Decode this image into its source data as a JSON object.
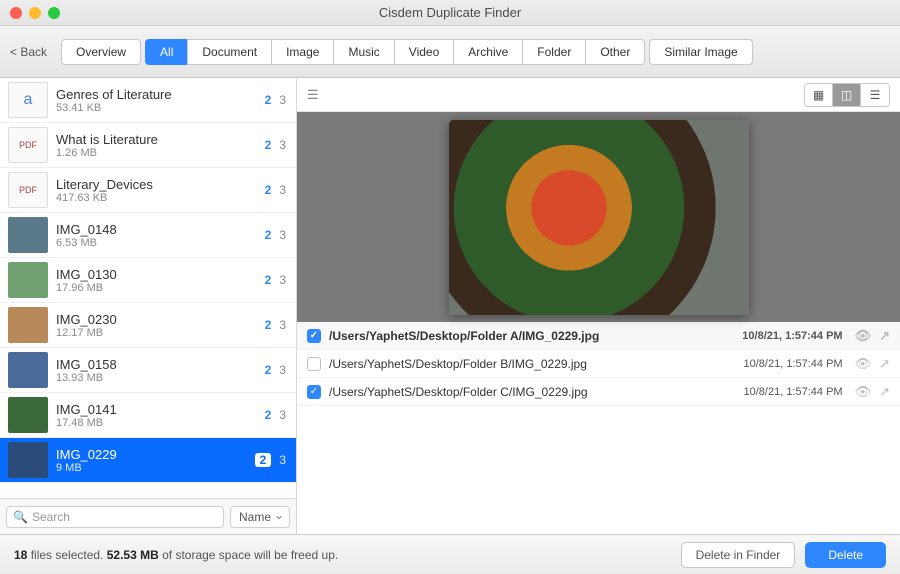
{
  "window": {
    "title": "Cisdem Duplicate Finder",
    "back": "< Back"
  },
  "tabs": {
    "overview": "Overview",
    "categories": [
      "All",
      "Document",
      "Image",
      "Music",
      "Video",
      "Archive",
      "Folder",
      "Other"
    ],
    "active": "All",
    "similar": "Similar Image"
  },
  "list": [
    {
      "name": "Genres of Literature",
      "size": "53.41 KB",
      "selected": 2,
      "total": 3,
      "kind": "doc"
    },
    {
      "name": "What is Literature",
      "size": "1.26 MB",
      "selected": 2,
      "total": 3,
      "kind": "pdf"
    },
    {
      "name": "Literary_Devices",
      "size": "417.63 KB",
      "selected": 2,
      "total": 3,
      "kind": "pdf"
    },
    {
      "name": "IMG_0148",
      "size": "6.53 MB",
      "selected": 2,
      "total": 3,
      "kind": "img"
    },
    {
      "name": "IMG_0130",
      "size": "17.96 MB",
      "selected": 2,
      "total": 3,
      "kind": "img"
    },
    {
      "name": "IMG_0230",
      "size": "12.17 MB",
      "selected": 2,
      "total": 3,
      "kind": "img"
    },
    {
      "name": "IMG_0158",
      "size": "13.93 MB",
      "selected": 2,
      "total": 3,
      "kind": "img"
    },
    {
      "name": "IMG_0141",
      "size": "17.48 MB",
      "selected": 2,
      "total": 3,
      "kind": "img"
    },
    {
      "name": "IMG_0229",
      "size": "9 MB",
      "selected": 2,
      "total": 3,
      "kind": "img",
      "active": true
    }
  ],
  "sidebar_footer": {
    "search_placeholder": "Search",
    "sort": "Name"
  },
  "detail": {
    "duplicates": [
      {
        "checked": true,
        "path": "/Users/YaphetS/Desktop/Folder A/IMG_0229.jpg",
        "date": "10/8/21, 1:57:44 PM"
      },
      {
        "checked": false,
        "path": "/Users/YaphetS/Desktop/Folder B/IMG_0229.jpg",
        "date": "10/8/21, 1:57:44 PM"
      },
      {
        "checked": true,
        "path": "/Users/YaphetS/Desktop/Folder C/IMG_0229.jpg",
        "date": "10/8/21, 1:57:44 PM"
      }
    ]
  },
  "status": {
    "files_selected": "18",
    "t1": " files selected. ",
    "space": "52.53 MB",
    "t2": " of storage space will be freed up."
  },
  "buttons": {
    "delete_in_finder": "Delete in Finder",
    "delete": "Delete"
  }
}
